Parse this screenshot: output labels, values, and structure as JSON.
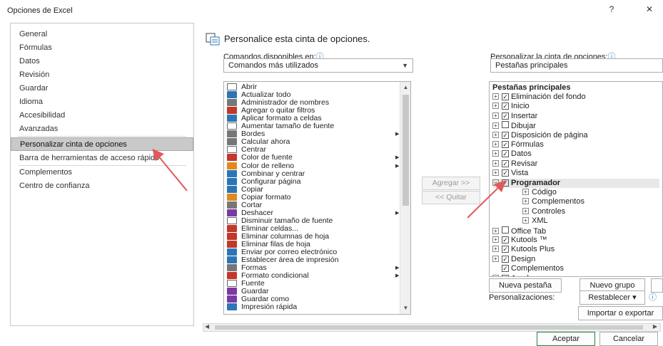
{
  "window": {
    "title": "Opciones de Excel",
    "help_glyph": "?",
    "close_glyph": "✕"
  },
  "nav": {
    "items": [
      {
        "label": "General"
      },
      {
        "label": "Fórmulas"
      },
      {
        "label": "Datos"
      },
      {
        "label": "Revisión"
      },
      {
        "label": "Guardar"
      },
      {
        "label": "Idioma"
      },
      {
        "label": "Accesibilidad"
      },
      {
        "label": "Avanzadas"
      },
      {
        "label": "Personalizar cinta de opciones",
        "selected": true
      },
      {
        "label": "Barra de herramientas de acceso rápido"
      },
      {
        "label": "Complementos"
      },
      {
        "label": "Centro de confianza"
      }
    ]
  },
  "header": {
    "text": "Personalice esta cinta de opciones.",
    "icon": "ribbon-customize-icon"
  },
  "left": {
    "label": "Comandos disponibles en:",
    "info_glyph": "ⓘ",
    "dropdown_value": "Comandos más utilizados",
    "commands": [
      {
        "label": "Abrir",
        "icon": "folder-open-icon"
      },
      {
        "label": "Actualizar todo",
        "icon": "refresh-all-icon"
      },
      {
        "label": "Administrador de nombres",
        "icon": "name-manager-icon"
      },
      {
        "label": "Agregar o quitar filtros",
        "icon": "filter-icon"
      },
      {
        "label": "Aplicar formato a celdas",
        "icon": "format-cells-icon"
      },
      {
        "label": "Aumentar tamaño de fuente",
        "icon": "increase-font-icon"
      },
      {
        "label": "Bordes",
        "icon": "borders-icon",
        "submenu": true
      },
      {
        "label": "Calcular ahora",
        "icon": "calculator-icon"
      },
      {
        "label": "Centrar",
        "icon": "align-center-icon"
      },
      {
        "label": "Color de fuente",
        "icon": "font-color-icon",
        "submenu": true
      },
      {
        "label": "Color de relleno",
        "icon": "fill-color-icon",
        "submenu": true
      },
      {
        "label": "Combinar y centrar",
        "icon": "merge-center-icon"
      },
      {
        "label": "Configurar página",
        "icon": "page-setup-icon"
      },
      {
        "label": "Copiar",
        "icon": "copy-icon"
      },
      {
        "label": "Copiar formato",
        "icon": "format-painter-icon"
      },
      {
        "label": "Cortar",
        "icon": "cut-icon"
      },
      {
        "label": "Deshacer",
        "icon": "undo-icon",
        "submenu": true
      },
      {
        "label": "Disminuir tamaño de fuente",
        "icon": "decrease-font-icon"
      },
      {
        "label": "Eliminar celdas...",
        "icon": "delete-cells-icon"
      },
      {
        "label": "Eliminar columnas de hoja",
        "icon": "delete-columns-icon"
      },
      {
        "label": "Eliminar filas de hoja",
        "icon": "delete-rows-icon"
      },
      {
        "label": "Enviar por correo electrónico",
        "icon": "email-icon"
      },
      {
        "label": "Establecer área de impresión",
        "icon": "print-area-icon"
      },
      {
        "label": "Formas",
        "icon": "shapes-icon",
        "submenu": true
      },
      {
        "label": "Formato condicional",
        "icon": "conditional-format-icon",
        "submenu": true
      },
      {
        "label": "Fuente",
        "icon": "font-box-icon"
      },
      {
        "label": "Guardar",
        "icon": "save-icon"
      },
      {
        "label": "Guardar como",
        "icon": "save-as-icon"
      },
      {
        "label": "Impresión rápida",
        "icon": "quick-print-icon"
      }
    ]
  },
  "middle": {
    "add_label": "Agregar >>",
    "remove_label": "<< Quitar"
  },
  "right": {
    "label": "Personalizar la cinta de opciones:",
    "info_glyph": "ⓘ",
    "dropdown_value": "Pestañas principales",
    "tree_header": "Pestañas principales",
    "tabs": [
      {
        "label": "Eliminación del fondo",
        "checked": true,
        "level": 0
      },
      {
        "label": "Inicio",
        "checked": true,
        "level": 0
      },
      {
        "label": "Insertar",
        "checked": true,
        "level": 0
      },
      {
        "label": "Dibujar",
        "checked": false,
        "level": 0
      },
      {
        "label": "Disposición de página",
        "checked": true,
        "level": 0
      },
      {
        "label": "Fórmulas",
        "checked": true,
        "level": 0
      },
      {
        "label": "Datos",
        "checked": true,
        "level": 0
      },
      {
        "label": "Revisar",
        "checked": true,
        "level": 0
      },
      {
        "label": "Vista",
        "checked": true,
        "level": 0
      },
      {
        "label": "Programador",
        "checked": true,
        "level": 0,
        "expanded": true,
        "selected": true
      },
      {
        "label": "Código",
        "level": 1
      },
      {
        "label": "Complementos",
        "level": 1
      },
      {
        "label": "Controles",
        "level": 1
      },
      {
        "label": "XML",
        "level": 1
      },
      {
        "label": "Office Tab",
        "checked": false,
        "level": 0
      },
      {
        "label": "Kutools ™",
        "checked": true,
        "level": 0
      },
      {
        "label": "Kutools Plus",
        "checked": true,
        "level": 0
      },
      {
        "label": "Design",
        "checked": true,
        "level": 0
      },
      {
        "label": "Complementos",
        "checked": true,
        "level": 0,
        "no_expander": true
      },
      {
        "label": "Ayuda",
        "checked": true,
        "level": 0
      }
    ],
    "new_tab_label": "Nueva pestaña",
    "new_group_label": "Nuevo grupo",
    "customizations_label": "Personalizaciones:",
    "reset_label": "Restablecer ▾",
    "import_export_label": "Importar o exportar"
  },
  "footer": {
    "ok_label": "Aceptar",
    "cancel_label": "Cancelar"
  },
  "colors": {
    "selection_bg": "#c9c9c9",
    "annotation_arrow": "#e05a5a",
    "ok_border": "#2d7d46"
  }
}
